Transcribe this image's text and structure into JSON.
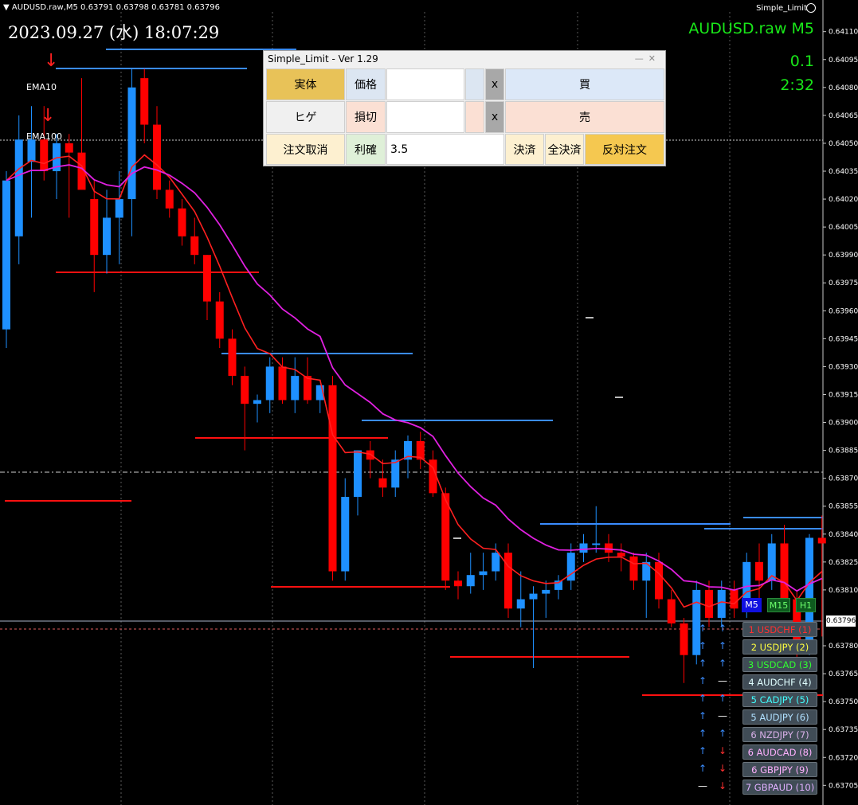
{
  "topbar": {
    "text": "AUDUSD.raw,M5  0.63791 0.63798 0.63781 0.63796",
    "ea_name": "Simple_Limit"
  },
  "clock": "2023.09.27 (水) 18:07:29",
  "symbol_display": "AUDUSD.raw  M5",
  "lot_display": "0.1",
  "time_display": "2:32",
  "ema_labels": {
    "fast": "EMA10",
    "slow": "EMA100"
  },
  "price_axis": [
    "0.64110",
    "0.64095",
    "0.64080",
    "0.64065",
    "0.64050",
    "0.64035",
    "0.64020",
    "0.64005",
    "0.63990",
    "0.63975",
    "0.63960",
    "0.63945",
    "0.63930",
    "0.63915",
    "0.63900",
    "0.63885",
    "0.63870",
    "0.63855",
    "0.63840",
    "0.63825",
    "0.63810",
    "0.63780",
    "0.63765",
    "0.63750",
    "0.63735",
    "0.63720",
    "0.63705"
  ],
  "current_price": "0.63796",
  "colors": {
    "bull": "#1e90ff",
    "bear": "#ff0000",
    "ema_fast": "#ff2020",
    "ema_slow": "#e020e0",
    "accent_green": "#19e619"
  },
  "panel": {
    "title": "Simple_Limit - Ver 1.29",
    "row1": {
      "mode": "実体",
      "price_label": "価格",
      "price_value": "",
      "clear": "x",
      "buy": "買"
    },
    "row2": {
      "mode": "ヒゲ",
      "sl_label": "損切",
      "sl_value": "",
      "clear": "x",
      "sell": "売"
    },
    "row3": {
      "cancel": "注文取消",
      "tp_label": "利確",
      "tp_value": "3.5",
      "close": "決済",
      "close_all": "全決済",
      "reverse": "反対注文"
    }
  },
  "timeframes": [
    "M5",
    "M15",
    "H1"
  ],
  "pairs": [
    {
      "label": "1 USDCHF (1)",
      "color": "#ff3030",
      "a1": "↑",
      "a2": "↑"
    },
    {
      "label": "2 USDJPY (2)",
      "color": "#ffff40",
      "a1": "↑",
      "a2": "↑"
    },
    {
      "label": "3 USDCAD (3)",
      "color": "#30ff30",
      "a1": "↑",
      "a2": "↑"
    },
    {
      "label": "4 AUDCHF (4)",
      "color": "#e0ffff",
      "a1": "↑",
      "a2": "—"
    },
    {
      "label": "5 CADJPY (5)",
      "color": "#40ffff",
      "a1": "↑",
      "a2": "↑"
    },
    {
      "label": "5 AUDJPY (6)",
      "color": "#b0e0ff",
      "a1": "↑",
      "a2": "—"
    },
    {
      "label": "6 NZDJPY (7)",
      "color": "#d8b0e8",
      "a1": "↑",
      "a2": "↑"
    },
    {
      "label": "6 AUDCAD (8)",
      "color": "#ffb0ff",
      "a1": "↑",
      "a2": "↓"
    },
    {
      "label": "6 GBPJPY (9)",
      "color": "#ffb0ff",
      "a1": "↑",
      "a2": "↓"
    },
    {
      "label": "7 GBPAUD (10)",
      "color": "#e0b0ff",
      "a1": "—",
      "a2": "↓"
    }
  ],
  "chart_data": {
    "type": "candlestick",
    "ylim": [
      0.637,
      0.64118
    ],
    "candles": [
      [
        0.6395,
        0.64035,
        0.6394,
        0.6403
      ],
      [
        0.64,
        0.64065,
        0.63985,
        0.64052
      ],
      [
        0.6404,
        0.6407,
        0.6401,
        0.64052
      ],
      [
        0.64052,
        0.6407,
        0.6403,
        0.64035
      ],
      [
        0.64035,
        0.64055,
        0.6402,
        0.6405
      ],
      [
        0.6405,
        0.64055,
        0.6401,
        0.64045
      ],
      [
        0.64045,
        0.64085,
        0.6403,
        0.64025
      ],
      [
        0.6402,
        0.6403,
        0.6397,
        0.6399
      ],
      [
        0.6399,
        0.64025,
        0.6398,
        0.6401
      ],
      [
        0.6401,
        0.64035,
        0.63985,
        0.6402
      ],
      [
        0.6402,
        0.6409,
        0.64,
        0.6408
      ],
      [
        0.64085,
        0.6409,
        0.6405,
        0.6406
      ],
      [
        0.6406,
        0.6407,
        0.6402,
        0.64025
      ],
      [
        0.64025,
        0.6403,
        0.6401,
        0.64015
      ],
      [
        0.64015,
        0.6402,
        0.63995,
        0.64
      ],
      [
        0.64,
        0.6401,
        0.63985,
        0.6399
      ],
      [
        0.6399,
        0.6399,
        0.63955,
        0.63965
      ],
      [
        0.63965,
        0.6397,
        0.6394,
        0.63945
      ],
      [
        0.63945,
        0.6395,
        0.6392,
        0.63925
      ],
      [
        0.63925,
        0.6393,
        0.63885,
        0.6391
      ],
      [
        0.6391,
        0.63915,
        0.639,
        0.63912
      ],
      [
        0.63912,
        0.63935,
        0.63905,
        0.6393
      ],
      [
        0.6393,
        0.63935,
        0.6391,
        0.63912
      ],
      [
        0.63912,
        0.63935,
        0.63905,
        0.63925
      ],
      [
        0.63925,
        0.63935,
        0.6391,
        0.63912
      ],
      [
        0.63912,
        0.6392,
        0.63905,
        0.6392
      ],
      [
        0.6392,
        0.63925,
        0.63815,
        0.6382
      ],
      [
        0.6382,
        0.6387,
        0.63815,
        0.6386
      ],
      [
        0.6386,
        0.63885,
        0.6385,
        0.63885
      ],
      [
        0.63885,
        0.6389,
        0.6387,
        0.6388
      ],
      [
        0.6387,
        0.6388,
        0.6386,
        0.63865
      ],
      [
        0.63865,
        0.63885,
        0.6386,
        0.6388
      ],
      [
        0.6388,
        0.63893,
        0.6387,
        0.6389
      ],
      [
        0.6389,
        0.63895,
        0.63875,
        0.6388
      ],
      [
        0.6388,
        0.63885,
        0.6386,
        0.63862
      ],
      [
        0.63862,
        0.63865,
        0.6381,
        0.63815
      ],
      [
        0.63815,
        0.6382,
        0.63805,
        0.63812
      ],
      [
        0.63812,
        0.6383,
        0.63808,
        0.63818
      ],
      [
        0.63818,
        0.6383,
        0.6381,
        0.6382
      ],
      [
        0.6382,
        0.63835,
        0.63815,
        0.6383
      ],
      [
        0.6383,
        0.63835,
        0.63795,
        0.638
      ],
      [
        0.638,
        0.6382,
        0.6379,
        0.63805
      ],
      [
        0.63805,
        0.63812,
        0.63768,
        0.63808
      ],
      [
        0.63808,
        0.63815,
        0.63795,
        0.6381
      ],
      [
        0.6381,
        0.63818,
        0.63805,
        0.63815
      ],
      [
        0.63815,
        0.63835,
        0.6381,
        0.6383
      ],
      [
        0.6383,
        0.6384,
        0.63825,
        0.63835
      ],
      [
        0.63835,
        0.63855,
        0.6383,
        0.63835
      ],
      [
        0.63835,
        0.6384,
        0.63825,
        0.6383
      ],
      [
        0.6383,
        0.63835,
        0.6382,
        0.63828
      ],
      [
        0.63828,
        0.6383,
        0.6381,
        0.63815
      ],
      [
        0.63815,
        0.6383,
        0.63795,
        0.63825
      ],
      [
        0.63825,
        0.6383,
        0.638,
        0.63805
      ],
      [
        0.63805,
        0.6381,
        0.6379,
        0.63792
      ],
      [
        0.63792,
        0.63795,
        0.6376,
        0.63775
      ],
      [
        0.63775,
        0.63815,
        0.6377,
        0.6381
      ],
      [
        0.6381,
        0.63815,
        0.6379,
        0.63795
      ],
      [
        0.63795,
        0.63815,
        0.6379,
        0.6381
      ],
      [
        0.6381,
        0.63815,
        0.63795,
        0.638
      ],
      [
        0.638,
        0.6383,
        0.63795,
        0.63825
      ],
      [
        0.63825,
        0.63835,
        0.63805,
        0.63815
      ],
      [
        0.63815,
        0.6384,
        0.6381,
        0.63835
      ],
      [
        0.63835,
        0.63845,
        0.638,
        0.63805
      ],
      [
        0.63805,
        0.6381,
        0.6377,
        0.6378
      ],
      [
        0.6378,
        0.6384,
        0.63775,
        0.63838
      ],
      [
        0.63838,
        0.6385,
        0.63785,
        0.63835
      ]
    ]
  }
}
